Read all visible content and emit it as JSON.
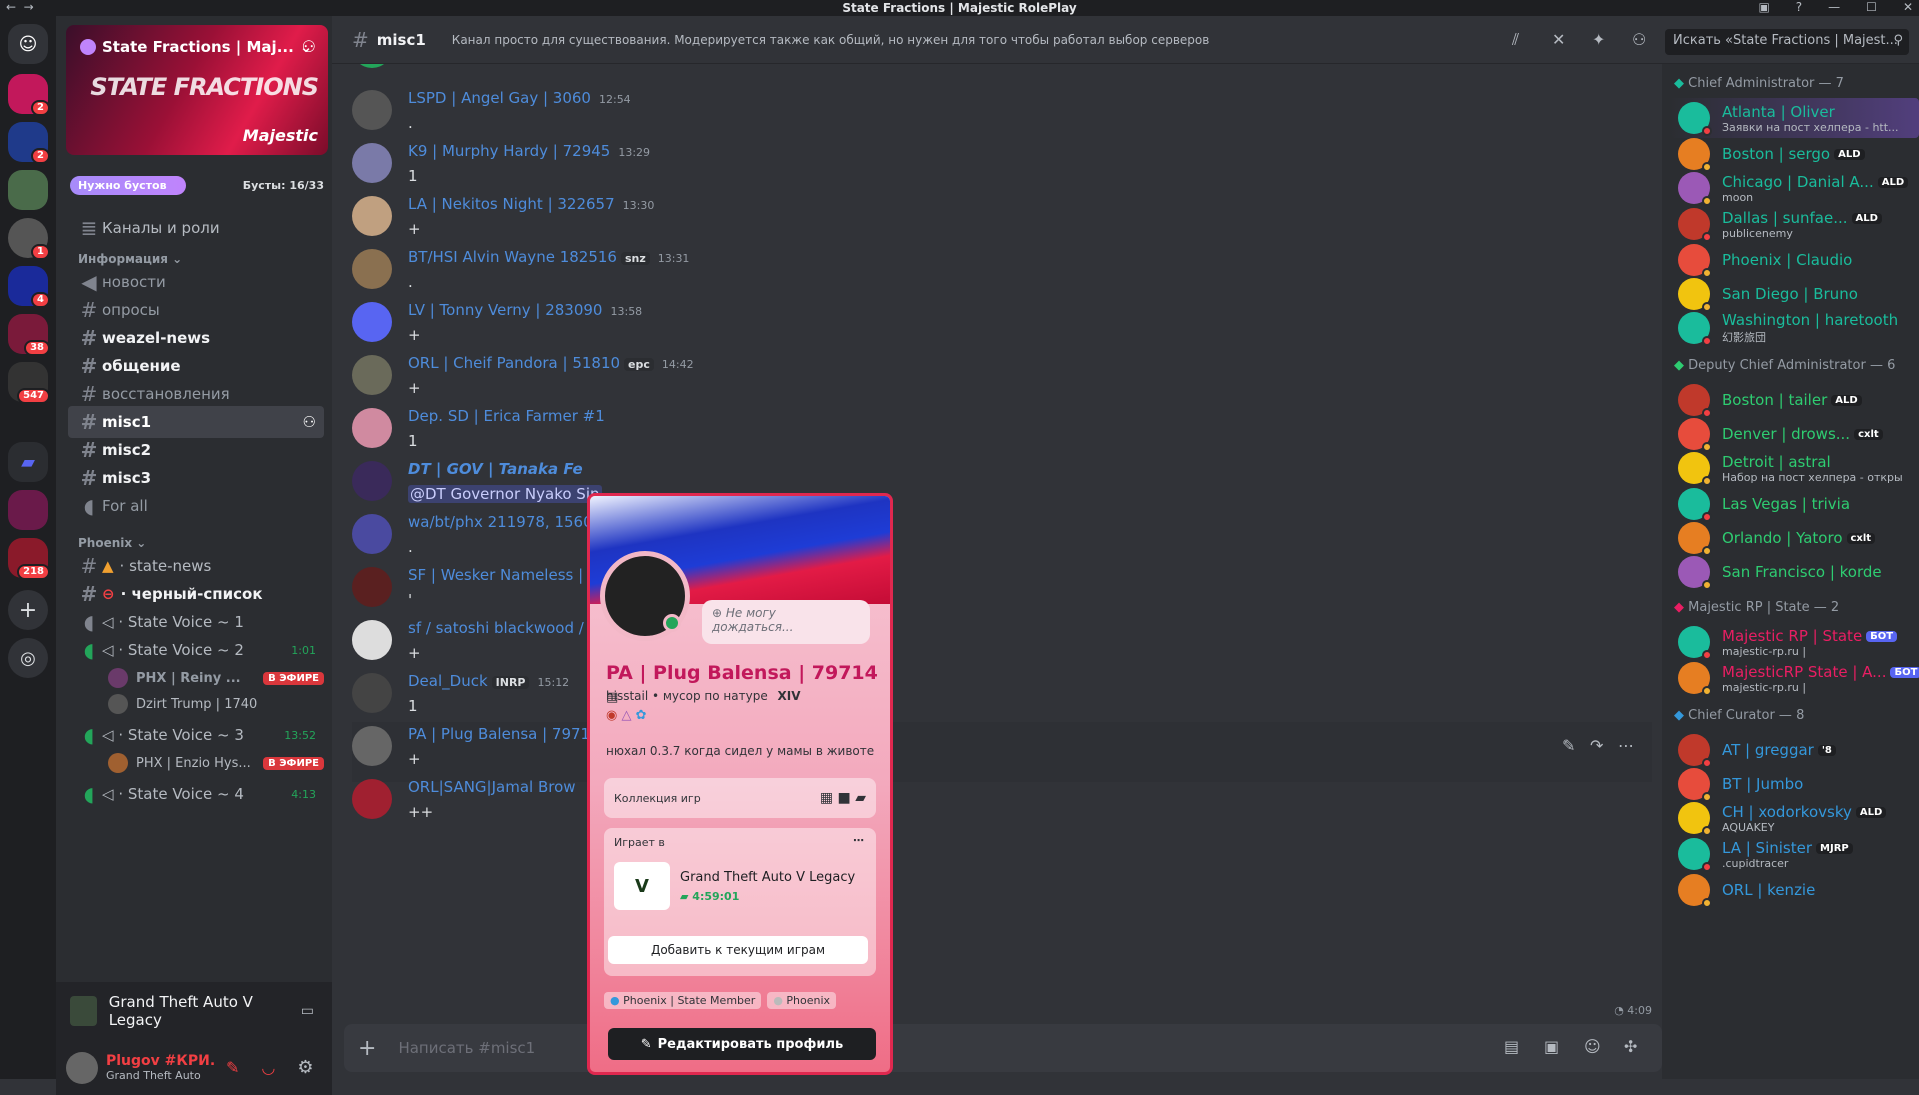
{
  "window": {
    "title": "State Fractions | Majestic RolePlay"
  },
  "server": {
    "name": "State Fractions | Maj...",
    "banner_big": "STATE FRACTIONS",
    "banner_brand": "Majestic",
    "boost_label": "Нужно бустов",
    "boost_count": "Бусты: 16/33",
    "channels_roles": "Каналы и роли"
  },
  "rail": {
    "badges": [
      "2",
      "2",
      "1",
      "4",
      "38",
      "547",
      "218"
    ]
  },
  "channels": {
    "cat_info": "Информация",
    "items": [
      "новости",
      "опросы",
      "weazel-news",
      "общение",
      "восстановления",
      "misc1",
      "misc2",
      "misc3",
      "For all"
    ],
    "cat_phoenix": "Phoenix",
    "phoenix": [
      "state-news",
      "черный-список",
      "State Voice ~ 1",
      "State Voice ~ 2",
      "State Voice ~ 3",
      "State Voice ~ 4"
    ],
    "timers": [
      "1:01",
      "13:52",
      "4:13"
    ],
    "voice_users": [
      "PHX | Reiny ...",
      "Dzirt Trump | 1740",
      "PHX | Enzio Hys..."
    ],
    "live": "В ЭФИРЕ"
  },
  "activity": {
    "game": "Grand Theft Auto V Legacy"
  },
  "user": {
    "name": "Plugov #КРИ...",
    "status": "Grand Theft Auto"
  },
  "topbar": {
    "channel": "misc1",
    "topic": "Канал просто для существования. Модерируется также как общий, но нужен для того чтобы работал выбор серверов",
    "search": "Искать «State Fractions | Majest..."
  },
  "messages": [
    {
      "name": "LSPD | Angel Gay | 3060",
      "time": "12:54",
      "text": ".",
      "tag": ""
    },
    {
      "name": "K9 | Murphy Hardy | 72945",
      "time": "13:29",
      "text": "1",
      "tag": ""
    },
    {
      "name": "LA | Nekitos Night | 322657",
      "time": "13:30",
      "text": "+",
      "tag": ""
    },
    {
      "name": "BT/HSI Alvin Wayne 182516",
      "time": "13:31",
      "text": ".",
      "tag": "snz"
    },
    {
      "name": "LV | Tonny Verny | 283090",
      "time": "13:58",
      "text": "+",
      "tag": ""
    },
    {
      "name": "ORL | Cheif Pandora | 51810",
      "time": "14:42",
      "text": "+",
      "tag": "epc"
    },
    {
      "name": "Dep. SD | Erica Farmer #1",
      "time": "",
      "text": "1",
      "tag": ""
    },
    {
      "name": "DT | GOV | Tanaka Fe",
      "time": "",
      "text": "@DT Governor Nyako Sin",
      "tag": ""
    },
    {
      "name": "wa/bt/phx 211978, 156065",
      "time": "",
      "text": ".",
      "tag": ""
    },
    {
      "name": "SF | Wesker Nameless | 13",
      "time": "",
      "text": "'",
      "tag": ""
    },
    {
      "name": "sf / satoshi blackwood / 4",
      "time": "",
      "text": "+",
      "tag": ""
    },
    {
      "name": "Deal_Duck",
      "time": "15:12",
      "text": "1",
      "tag": "INRP"
    },
    {
      "name": "PA | Plug Balensa | 79714",
      "time": "",
      "text": "+",
      "tag": ""
    },
    {
      "name": "ORL|SANG|Jamal Brow",
      "time": "",
      "text": "++",
      "tag": ""
    }
  ],
  "last_time": "4:09",
  "composer": {
    "placeholder": "Написать #misc1"
  },
  "popout": {
    "bubble": "Не могу дождаться...",
    "name": "PA | Plug Balensa | 79714",
    "sub": "hisstail • мусор по натуре",
    "sub_tag": "XIV",
    "bio": "нюхал 0.3.7 когда сидел у мамы в животе",
    "collection": "Коллекция игр",
    "playing": "Играет в",
    "game": "Grand Theft Auto V Legacy",
    "elapsed": "4:59:01",
    "add": "Добавить к текущим играм",
    "roles": [
      "Phoenix | State Member",
      "Phoenix"
    ],
    "edit": "Редактировать профиль"
  },
  "members": {
    "groups": [
      {
        "title": "Chief Administrator — 7",
        "color": "#1abc9c",
        "items": [
          {
            "name": "Atlanta | Oliver",
            "sub": "Заявки на пост хелпера - htt...",
            "tag": ""
          },
          {
            "name": "Boston | sergo",
            "sub": "",
            "tag": "ALD"
          },
          {
            "name": "Chicago | Danial A...",
            "sub": "moon",
            "tag": "ALD"
          },
          {
            "name": "Dallas | sunfae...",
            "sub": "publicenemy",
            "tag": "ALD"
          },
          {
            "name": "Phoenix | Claudio",
            "sub": "",
            "tag": ""
          },
          {
            "name": "San Diego | Bruno",
            "sub": "",
            "tag": ""
          },
          {
            "name": "Washington | haretooth",
            "sub": "幻影旅団",
            "tag": ""
          }
        ]
      },
      {
        "title": "Deputy Chief Administrator — 6",
        "color": "#2ecc71",
        "items": [
          {
            "name": "Boston | tailer",
            "sub": "",
            "tag": "ALD"
          },
          {
            "name": "Denver | drows...",
            "sub": "",
            "tag": "cxlt"
          },
          {
            "name": "Detroit | astral",
            "sub": "Набор на пост хелпера - откры",
            "tag": ""
          },
          {
            "name": "Las Vegas | trivia",
            "sub": "",
            "tag": ""
          },
          {
            "name": "Orlando | Yatoro",
            "sub": "",
            "tag": "cxlt"
          },
          {
            "name": "San Francisco | korde",
            "sub": "",
            "tag": ""
          }
        ]
      },
      {
        "title": "Majestic RP | State — 2",
        "color": "#e91e63",
        "items": [
          {
            "name": "Majestic RP | State",
            "sub": "majestic-rp.ru |",
            "tag": "БОТ"
          },
          {
            "name": "MajesticRP State | A...",
            "sub": "majestic-rp.ru |",
            "tag": "БОТ"
          }
        ]
      },
      {
        "title": "Chief Curator — 8",
        "color": "#3498db",
        "items": [
          {
            "name": "AT | greggar",
            "sub": "",
            "tag": "'8"
          },
          {
            "name": "BT | Jumbo",
            "sub": "",
            "tag": ""
          },
          {
            "name": "CH | xodorkovsky",
            "sub": "AQUAKEY",
            "tag": "ALD"
          },
          {
            "name": "LA | Sinister",
            "sub": ".cupidtracer",
            "tag": "MJRP"
          },
          {
            "name": "ORL | kenzie",
            "sub": "",
            "tag": ""
          }
        ]
      }
    ]
  }
}
